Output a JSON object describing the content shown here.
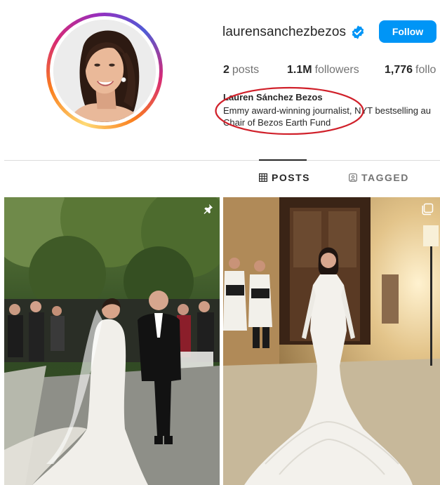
{
  "profile": {
    "username": "laurensanchezbezos",
    "follow_label": "Follow",
    "verified_icon": "verified-badge-icon",
    "name": "Lauren Sánchez Bezos",
    "bio_line1": "Emmy award-winning journalist, NYT bestselling au",
    "bio_line2": "Chair of Bezos Earth Fund"
  },
  "stats": {
    "posts_count": "2",
    "posts_label": "posts",
    "followers_count": "1.1M",
    "followers_label": "followers",
    "following_count": "1,776",
    "following_label": "follo"
  },
  "tabs": [
    {
      "label": "POSTS",
      "icon": "grid-icon",
      "active": true
    },
    {
      "label": "TAGGED",
      "icon": "tag-icon",
      "active": false
    }
  ],
  "posts": [
    {
      "overlay_icon": "pin-icon"
    },
    {
      "overlay_icon": "carousel-icon"
    }
  ],
  "colors": {
    "follow_button": "#0095f6",
    "verified": "#0095f6",
    "annotation_ellipse": "#d0202a"
  }
}
